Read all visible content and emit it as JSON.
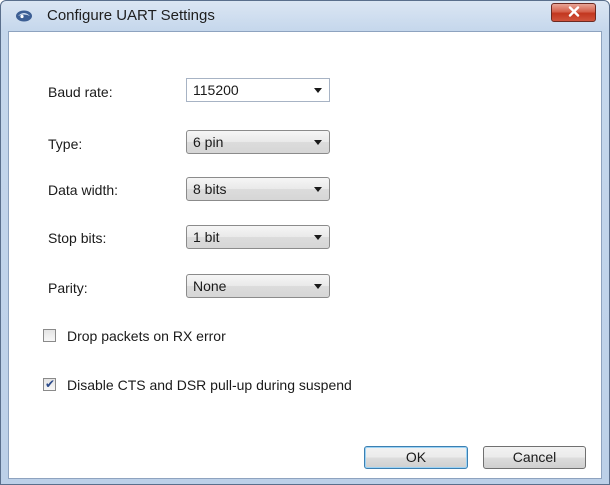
{
  "window": {
    "title": "Configure UART Settings"
  },
  "fields": [
    {
      "label": "Baud rate:",
      "value": "115200",
      "style": "editable"
    },
    {
      "label": "Type:",
      "value": "6 pin",
      "style": "dropdown"
    },
    {
      "label": "Data width:",
      "value": "8 bits",
      "style": "dropdown"
    },
    {
      "label": "Stop bits:",
      "value": "1 bit",
      "style": "dropdown"
    },
    {
      "label": "Parity:",
      "value": "None",
      "style": "dropdown"
    }
  ],
  "checkboxes": [
    {
      "label": "Drop packets on RX error",
      "checked": false
    },
    {
      "label": "Disable CTS and DSR pull-up during suspend",
      "checked": true
    }
  ],
  "buttons": {
    "ok_label": "OK",
    "cancel_label": "Cancel"
  },
  "colors": {
    "close_button": "#c2371f",
    "default_button_border": "#3c7fb1",
    "checkmark": "#2c4b8a"
  }
}
